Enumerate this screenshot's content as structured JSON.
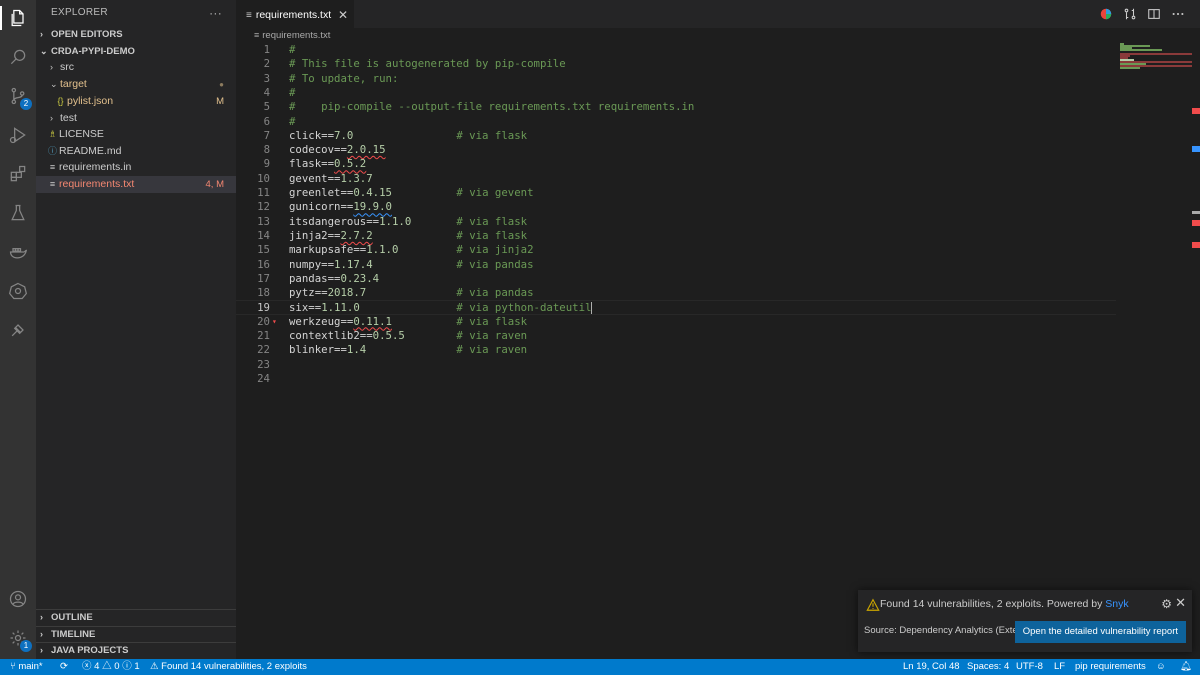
{
  "sidebar": {
    "title": "EXPLORER",
    "more_label": "···",
    "sections": {
      "open_editors": "OPEN EDITORS",
      "project": "CRDA-PYPI-DEMO",
      "outline": "OUTLINE",
      "timeline": "TIMELINE",
      "java_projects": "JAVA PROJECTS"
    },
    "tree": [
      {
        "label": "src",
        "status": ""
      },
      {
        "label": "target",
        "status": "●"
      },
      {
        "label": "pylist.json",
        "status": "M"
      },
      {
        "label": "test",
        "status": ""
      },
      {
        "label": "LICENSE",
        "status": ""
      },
      {
        "label": "README.md",
        "status": ""
      },
      {
        "label": "requirements.in",
        "status": ""
      },
      {
        "label": "requirements.txt",
        "status": "4, M"
      }
    ]
  },
  "activity": {
    "scm_badge": "2",
    "settings_badge": "1"
  },
  "tab": {
    "label": "requirements.txt",
    "icon": "≡",
    "close": "✕"
  },
  "breadcrumb": "requirements.txt",
  "editor": {
    "lines": [
      {
        "n": "1",
        "pkg": "#",
        "ver": "",
        "comment": ""
      },
      {
        "n": "2",
        "pkg": "# This file is autogenerated by pip-compile",
        "ver": "",
        "comment": ""
      },
      {
        "n": "3",
        "pkg": "# To update, run:",
        "ver": "",
        "comment": ""
      },
      {
        "n": "4",
        "pkg": "#",
        "ver": "",
        "comment": ""
      },
      {
        "n": "5",
        "pkg": "#    pip-compile --output-file requirements.txt requirements.in",
        "ver": "",
        "comment": ""
      },
      {
        "n": "6",
        "pkg": "#",
        "ver": "",
        "comment": ""
      },
      {
        "n": "7",
        "pkg": "click==",
        "ver": "7.0",
        "comment": "# via flask"
      },
      {
        "n": "8",
        "pkg": "codecov==",
        "ver": "2.0.15",
        "comment": ""
      },
      {
        "n": "9",
        "pkg": "flask==",
        "ver": "0.5.2",
        "comment": ""
      },
      {
        "n": "10",
        "pkg": "gevent==",
        "ver": "1.3.7",
        "comment": ""
      },
      {
        "n": "11",
        "pkg": "greenlet==",
        "ver": "0.4.15",
        "comment": "# via gevent"
      },
      {
        "n": "12",
        "pkg": "gunicorn==",
        "ver": "19.9.0",
        "comment": ""
      },
      {
        "n": "13",
        "pkg": "itsdangerous==",
        "ver": "1.1.0",
        "comment": "# via flask"
      },
      {
        "n": "14",
        "pkg": "jinja2==",
        "ver": "2.7.2",
        "comment": "# via flask"
      },
      {
        "n": "15",
        "pkg": "markupsafe==",
        "ver": "1.1.0",
        "comment": "# via jinja2"
      },
      {
        "n": "16",
        "pkg": "numpy==",
        "ver": "1.17.4",
        "comment": "# via pandas"
      },
      {
        "n": "17",
        "pkg": "pandas==",
        "ver": "0.23.4",
        "comment": ""
      },
      {
        "n": "18",
        "pkg": "pytz==",
        "ver": "2018.7",
        "comment": "# via pandas"
      },
      {
        "n": "19",
        "pkg": "six==",
        "ver": "1.11.0",
        "comment": "# via python-dateutil"
      },
      {
        "n": "20",
        "pkg": "werkzeug==",
        "ver": "0.11.1",
        "comment": "# via flask"
      },
      {
        "n": "21",
        "pkg": "contextlib2==",
        "ver": "0.5.5",
        "comment": "# via raven"
      },
      {
        "n": "22",
        "pkg": "blinker==",
        "ver": "1.4",
        "comment": "# via raven"
      },
      {
        "n": "23",
        "pkg": "",
        "ver": "",
        "comment": ""
      },
      {
        "n": "24",
        "pkg": "",
        "ver": "",
        "comment": ""
      }
    ]
  },
  "notification": {
    "message_prefix": "Found 14 vulnerabilities, 2 exploits. Powered by ",
    "message_link": "Snyk",
    "source": "Source: Dependency Analytics (Exte...",
    "button": "Open the detailed vulnerability report",
    "close": "✕",
    "gear": "⚙"
  },
  "status": {
    "branch": "main*",
    "sync": "⟳",
    "errors": "4",
    "warnings": "0",
    "infos": "1",
    "vuln": "Found 14 vulnerabilities, 2 exploits",
    "position": "Ln 19, Col 48",
    "spaces": "Spaces: 4",
    "encoding": "UTF-8",
    "eol": "LF",
    "language": "pip requirements"
  },
  "colors": {
    "accent": "#007acc",
    "button": "#0e639c",
    "link": "#3794ff",
    "error": "#f14c4c",
    "warning": "#cca700"
  }
}
